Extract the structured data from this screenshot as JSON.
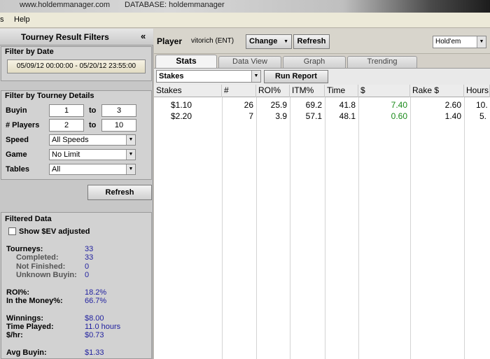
{
  "banner": {
    "url": "www.holdemmanager.com",
    "database": "DATABASE: holdemmanager"
  },
  "menu": {
    "items": [
      "s",
      "Help"
    ]
  },
  "filters": {
    "title": "Tourney Result Filters",
    "collapse_icon": "«",
    "by_date": {
      "title": "Filter by Date",
      "range": "05/09/12 00:00:00 - 05/20/12 23:55:00"
    },
    "details": {
      "title": "Filter by Tourney Details",
      "buyin_label": "Buyin",
      "buyin_from": "1",
      "buyin_to": "3",
      "players_label": "# Players",
      "players_from": "2",
      "players_to": "10",
      "to": "to",
      "speed_label": "Speed",
      "speed_value": "All Speeds",
      "game_label": "Game",
      "game_value": "No Limit",
      "tables_label": "Tables",
      "tables_value": "All"
    },
    "refresh_label": "Refresh",
    "filtered": {
      "title": "Filtered Data",
      "show_ev": "Show $EV adjusted",
      "tourneys_label": "Tourneys:",
      "tourneys": "33",
      "completed_label": "Completed:",
      "completed": "33",
      "not_finished_label": "Not Finished:",
      "not_finished": "0",
      "unknown_label": "Unknown Buyin:",
      "unknown": "0",
      "roi_label": "ROI%:",
      "roi": "18.2%",
      "itm_label": "In the Money%:",
      "itm": "66.7%",
      "winnings_label": "Winnings:",
      "winnings": "$8.00",
      "time_label": "Time Played:",
      "time": "11.0 hours",
      "hr_label": "$/hr:",
      "hr": "$0.73",
      "avg_label": "Avg Buyin:",
      "avg": "$1.33"
    }
  },
  "player": {
    "label": "Player",
    "name": "vitorich (ENT)",
    "change_label": "Change",
    "refresh_label": "Refresh",
    "game_select": "Hold'em"
  },
  "tabs": [
    "Stats",
    "Data View",
    "Graph",
    "Trending"
  ],
  "toolbar": {
    "group_by": "Stakes",
    "run_label": "Run Report"
  },
  "table": {
    "columns": [
      "Stakes",
      "#",
      "ROI%",
      "ITM%",
      "Time",
      "$",
      "Rake $",
      "Hours"
    ],
    "rows": [
      [
        "$1.10",
        "26",
        "25.9",
        "69.2",
        "41.8",
        "7.40",
        "2.60",
        "10."
      ],
      [
        "$2.20",
        "7",
        "3.9",
        "57.1",
        "48.1",
        "0.60",
        "1.40",
        "5."
      ]
    ]
  },
  "colors": {
    "positive": "#1a8a1a",
    "stat_value": "#1f1f9f"
  }
}
